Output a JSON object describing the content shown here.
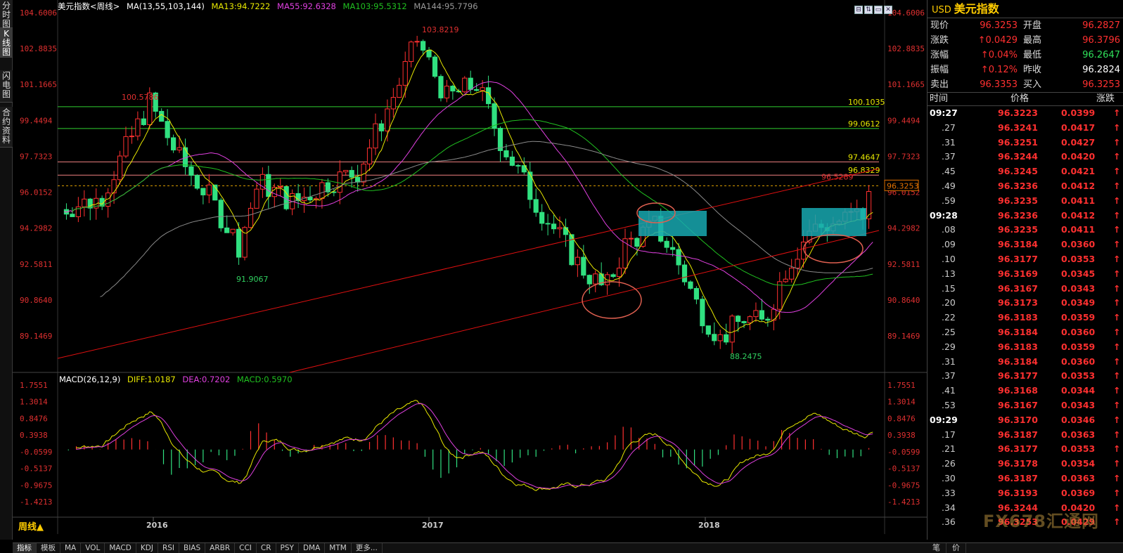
{
  "left_tabs": [
    "分时图",
    "K线图",
    "闪电图",
    "合约资料"
  ],
  "title": {
    "name": "美元指数<周线>",
    "ma_label": "MA(13,55,103,144)",
    "ma13": "MA13:94.7222",
    "ma55": "MA55:92.6328",
    "ma103": "MA103:95.5312",
    "ma144": "MA144:95.7796"
  },
  "window_buttons": [
    "⊟",
    "⇅",
    "▭",
    "✕"
  ],
  "colors": {
    "ma13": "#e8e800",
    "ma55": "#e040e0",
    "ma103": "#20c020",
    "ma144": "#8a8a8a",
    "bull": "#ff3030",
    "bear": "#30e080",
    "trend": "#e01010",
    "box": "#18a8b0",
    "ellipse": "#e06050",
    "fib": "#30d030",
    "fib_pink": "#f08080"
  },
  "price_axis": [
    "104.6006",
    "102.8835",
    "101.1665",
    "99.4494",
    "97.7323",
    "96.0152",
    "94.2982",
    "92.5811",
    "90.8640",
    "89.1469"
  ],
  "price_labels": {
    "high": "103.8219",
    "hi2016": "100.5786",
    "low2016": "91.9067",
    "low2018": "88.2475",
    "l1": "100.1035",
    "l2": "99.0612",
    "l3": "97.4647",
    "l4": "96.8329",
    "l5": "96.5289",
    "current": "96.3253"
  },
  "macd": {
    "label": "MACD(26,12,9)",
    "diff": "DIFF:1.0187",
    "dea": "DEA:0.7202",
    "macd": "MACD:0.5970",
    "axis": [
      "1.7551",
      "1.3014",
      "0.8476",
      "0.3938",
      "-0.0599",
      "-0.5137",
      "-0.9675",
      "-1.4213"
    ]
  },
  "x_axis": [
    "2016",
    "2017",
    "2018"
  ],
  "period": "周线▲",
  "tabs": [
    "指标",
    "模板",
    "MA",
    "VOL",
    "MACD",
    "KDJ",
    "RSI",
    "BIAS",
    "ARBR",
    "CCI",
    "CR",
    "PSY",
    "DMA",
    "MTM",
    "更多..."
  ],
  "quote": {
    "symbol": "USD",
    "name": "美元指数",
    "rows": [
      {
        "k": "现价",
        "v": "96.3253",
        "vc": "up",
        "k2": "开盘",
        "v2": "96.2827",
        "v2c": "up"
      },
      {
        "k": "涨跌",
        "v": "↑0.0429",
        "vc": "up",
        "k2": "最高",
        "v2": "96.3796",
        "v2c": "up"
      },
      {
        "k": "涨幅",
        "v": "↑0.04%",
        "vc": "up",
        "k2": "最低",
        "v2": "96.2647",
        "v2c": "dn"
      },
      {
        "k": "振幅",
        "v": "↑0.12%",
        "vc": "up",
        "k2": "昨收",
        "v2": "96.2824",
        "v2c": "wh"
      },
      {
        "k": "卖出",
        "v": "96.3353",
        "vc": "up",
        "k2": "买入",
        "v2": "96.3253",
        "v2c": "up"
      }
    ]
  },
  "tick_header": {
    "time": "时间",
    "price": "价格",
    "change": "涨跌"
  },
  "ticks": [
    {
      "t": "09:27",
      "p": "96.3223",
      "c": "0.0399",
      "major": true
    },
    {
      "t": ".27",
      "p": "96.3241",
      "c": "0.0417"
    },
    {
      "t": ".31",
      "p": "96.3251",
      "c": "0.0427"
    },
    {
      "t": ".37",
      "p": "96.3244",
      "c": "0.0420"
    },
    {
      "t": ".45",
      "p": "96.3245",
      "c": "0.0421"
    },
    {
      "t": ".49",
      "p": "96.3236",
      "c": "0.0412"
    },
    {
      "t": ".59",
      "p": "96.3235",
      "c": "0.0411"
    },
    {
      "t": "09:28",
      "p": "96.3236",
      "c": "0.0412",
      "major": true
    },
    {
      "t": ".08",
      "p": "96.3235",
      "c": "0.0411"
    },
    {
      "t": ".09",
      "p": "96.3184",
      "c": "0.0360"
    },
    {
      "t": ".10",
      "p": "96.3177",
      "c": "0.0353"
    },
    {
      "t": ".13",
      "p": "96.3169",
      "c": "0.0345"
    },
    {
      "t": ".15",
      "p": "96.3167",
      "c": "0.0343"
    },
    {
      "t": ".20",
      "p": "96.3173",
      "c": "0.0349"
    },
    {
      "t": ".22",
      "p": "96.3183",
      "c": "0.0359"
    },
    {
      "t": ".25",
      "p": "96.3184",
      "c": "0.0360"
    },
    {
      "t": ".29",
      "p": "96.3183",
      "c": "0.0359"
    },
    {
      "t": ".31",
      "p": "96.3184",
      "c": "0.0360"
    },
    {
      "t": ".37",
      "p": "96.3177",
      "c": "0.0353"
    },
    {
      "t": ".41",
      "p": "96.3168",
      "c": "0.0344"
    },
    {
      "t": ".53",
      "p": "96.3167",
      "c": "0.0343"
    },
    {
      "t": "09:29",
      "p": "96.3170",
      "c": "0.0346",
      "major": true
    },
    {
      "t": ".17",
      "p": "96.3187",
      "c": "0.0363"
    },
    {
      "t": ".21",
      "p": "96.3177",
      "c": "0.0353"
    },
    {
      "t": ".26",
      "p": "96.3178",
      "c": "0.0354"
    },
    {
      "t": ".30",
      "p": "96.3187",
      "c": "0.0363"
    },
    {
      "t": ".33",
      "p": "96.3193",
      "c": "0.0369"
    },
    {
      "t": ".34",
      "p": "96.3244",
      "c": "0.0420"
    },
    {
      "t": ".36",
      "p": "96.3253",
      "c": "0.0429"
    }
  ],
  "rp_bottom": [
    "笔",
    "价"
  ],
  "watermark": "FX678汇通网"
}
